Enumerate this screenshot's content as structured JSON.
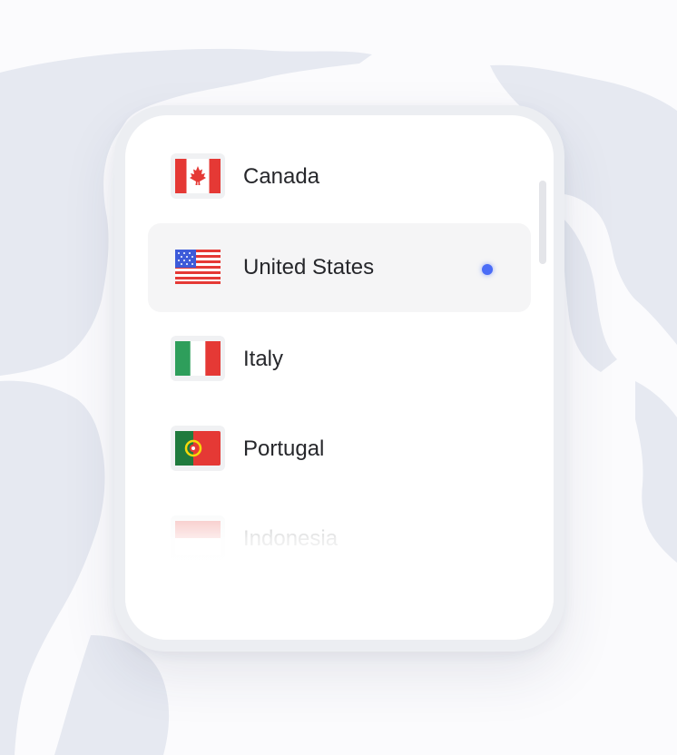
{
  "countries": [
    {
      "name": "Canada",
      "flag_icon": "canada-flag-icon",
      "selected": false
    },
    {
      "name": "United States",
      "flag_icon": "us-flag-icon",
      "selected": true
    },
    {
      "name": "Italy",
      "flag_icon": "italy-flag-icon",
      "selected": false
    },
    {
      "name": "Portugal",
      "flag_icon": "portugal-flag-icon",
      "selected": false
    },
    {
      "name": "Indonesia",
      "flag_icon": "indonesia-flag-icon",
      "selected": false
    }
  ],
  "colors": {
    "accent": "#4a6cf7",
    "map": "#e6e9f2",
    "selected_row": "#f5f5f6"
  }
}
